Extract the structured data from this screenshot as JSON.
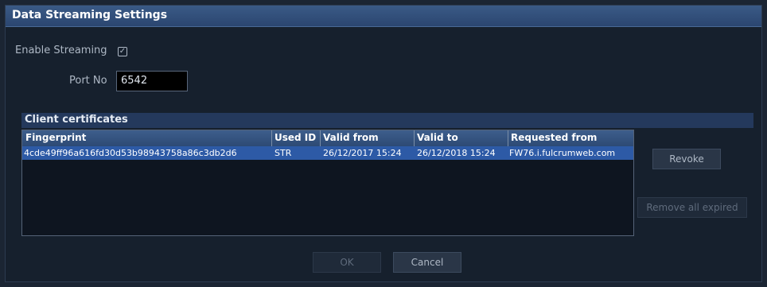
{
  "dialog": {
    "title": "Data Streaming Settings"
  },
  "streaming": {
    "enable_label": "Enable Streaming",
    "enabled": true,
    "check_glyph": "✓",
    "port_label": "Port No",
    "port_value": "6542"
  },
  "certs": {
    "section_title": "Client certificates",
    "columns": [
      "Fingerprint",
      "Used ID",
      "Valid from",
      "Valid to",
      "Requested from"
    ],
    "rows": [
      {
        "fingerprint": "4cde49ff96a616fd30d53b98943758a86c3db2d6",
        "used_id": "STR",
        "valid_from": "26/12/2017 15:24",
        "valid_to": "26/12/2018 15:24",
        "requested_from": "FW76.i.fulcrumweb.com"
      }
    ]
  },
  "buttons": {
    "revoke": "Revoke",
    "remove_expired": "Remove all expired",
    "ok": "OK",
    "cancel": "Cancel"
  },
  "colors": {
    "title_bar": "#2f4d78",
    "selection": "#2d5aa6",
    "background": "#16202d"
  }
}
